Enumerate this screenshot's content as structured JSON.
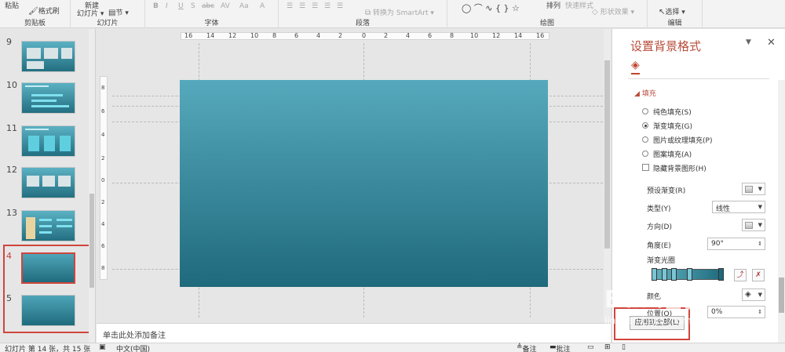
{
  "ribbon": {
    "clipboard": {
      "paste": "粘贴",
      "format_painter": "格式刷",
      "label": "剪贴板"
    },
    "slides": {
      "new_slide_line1": "新建",
      "new_slide_line2": "幻灯片",
      "section": "节",
      "label": "幻灯片"
    },
    "font": {
      "label": "字体",
      "bold": "B",
      "italic": "I",
      "underline": "U",
      "strike": "S",
      "abc": "abc",
      "av": "AV",
      "aa": "Aa",
      "a_color": "A"
    },
    "paragraph": {
      "label": "段落",
      "smartart": "转换为 SmartArt"
    },
    "drawing": {
      "label": "绘图",
      "arrange": "排列",
      "quick_styles": "快速样式",
      "shape_effects": "形状效果"
    },
    "editing": {
      "label": "编辑",
      "select": "选择"
    }
  },
  "thumbnails": [
    {
      "num": "9"
    },
    {
      "num": "10"
    },
    {
      "num": "11"
    },
    {
      "num": "12"
    },
    {
      "num": "13"
    },
    {
      "num": "4"
    },
    {
      "num": "5"
    }
  ],
  "ruler": {
    "h": [
      "16",
      "14",
      "12",
      "10",
      "8",
      "6",
      "4",
      "2",
      "0",
      "2",
      "4",
      "6",
      "8",
      "10",
      "12",
      "14",
      "16"
    ],
    "v": [
      "8",
      "6",
      "4",
      "2",
      "0",
      "2",
      "4",
      "6",
      "8"
    ]
  },
  "notes_placeholder": "单击此处添加备注",
  "pane": {
    "title": "设置背景格式",
    "section": "填充",
    "options": [
      {
        "label": "纯色填充(S)",
        "checked": false
      },
      {
        "label": "渐变填充(G)",
        "checked": true
      },
      {
        "label": "图片或纹理填充(P)",
        "checked": false
      },
      {
        "label": "图案填充(A)",
        "checked": false
      }
    ],
    "hide_bg": "隐藏背景图形(H)",
    "preset_label": "预设渐变(R)",
    "type_label": "类型(Y)",
    "type_value": "线性",
    "direction_label": "方向(D)",
    "angle_label": "角度(E)",
    "angle_value": "90°",
    "stops_label": "渐变光圈",
    "color_label": "颜色",
    "position_label": "位置(O)",
    "position_value": "0%",
    "apply_all": "应用到全部(L)"
  },
  "watermark": {
    "brand": "Bai 经验",
    "url": "jingyan.baidu.com"
  },
  "status": {
    "slide_info": "幻灯片 第 14 张，共 15 张",
    "language": "中文(中国)",
    "notes": "备注",
    "comments": "批注"
  },
  "colors": {
    "accent": "#b84d3a",
    "highlight": "#d0453b",
    "slide_top": "#56a9bc",
    "slide_bottom": "#1f6a7c"
  }
}
